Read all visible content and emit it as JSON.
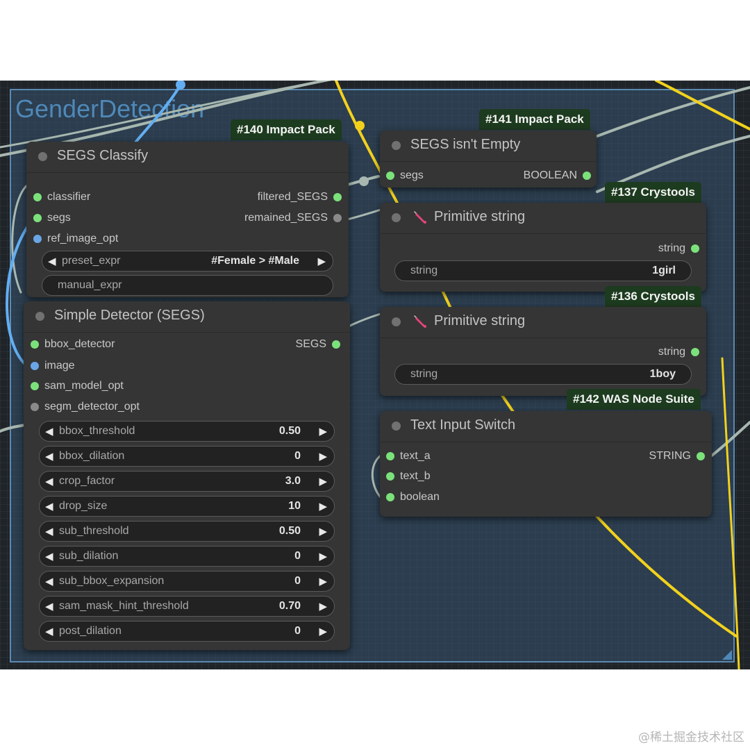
{
  "colors": {
    "input_connected": "#7be27b",
    "output_disconnected": "#8a8a8a",
    "image_slot": "#6aa6e6",
    "wire_yellow": "#f2d11c",
    "wire_blue": "#63aef2",
    "wire_gray": "#a8b8b0"
  },
  "group": {
    "title": "GenderDetection"
  },
  "nodes": {
    "segs_classify": {
      "badge": "#140 Impact Pack",
      "title": "SEGS Classify",
      "inputs": [
        "classifier",
        "segs",
        "ref_image_opt"
      ],
      "outputs": [
        "filtered_SEGS",
        "remained_SEGS"
      ],
      "preset_expr": {
        "label": "preset_expr",
        "value": "#Female > #Male"
      },
      "manual_expr": {
        "label": "manual_expr"
      }
    },
    "simple_detector": {
      "title": "Simple Detector (SEGS)",
      "inputs": [
        "bbox_detector",
        "image",
        "sam_model_opt",
        "segm_detector_opt"
      ],
      "outputs": [
        "SEGS"
      ],
      "widgets": [
        {
          "label": "bbox_threshold",
          "value": "0.50"
        },
        {
          "label": "bbox_dilation",
          "value": "0"
        },
        {
          "label": "crop_factor",
          "value": "3.0"
        },
        {
          "label": "drop_size",
          "value": "10"
        },
        {
          "label": "sub_threshold",
          "value": "0.50"
        },
        {
          "label": "sub_dilation",
          "value": "0"
        },
        {
          "label": "sub_bbox_expansion",
          "value": "0"
        },
        {
          "label": "sam_mask_hint_threshold",
          "value": "0.70"
        },
        {
          "label": "post_dilation",
          "value": "0"
        }
      ]
    },
    "segs_not_empty": {
      "badge": "#141 Impact Pack",
      "title": "SEGS isn't Empty",
      "inputs": [
        "segs"
      ],
      "outputs": [
        "BOOLEAN"
      ]
    },
    "primitive_1": {
      "badge": "#137 Crystools",
      "title": "Primitive string",
      "output": "string",
      "widget": {
        "label": "string",
        "value": "1girl"
      }
    },
    "primitive_2": {
      "badge": "#136 Crystools",
      "title": "Primitive string",
      "output": "string",
      "widget": {
        "label": "string",
        "value": "1boy"
      }
    },
    "text_switch": {
      "badge": "#142 WAS Node Suite",
      "title": "Text Input Switch",
      "inputs": [
        "text_a",
        "text_b",
        "boolean"
      ],
      "outputs": [
        "STRING"
      ]
    }
  },
  "arrows": {
    "left": "◀",
    "right": "▶"
  },
  "watermark": "@稀土掘金技术社区"
}
